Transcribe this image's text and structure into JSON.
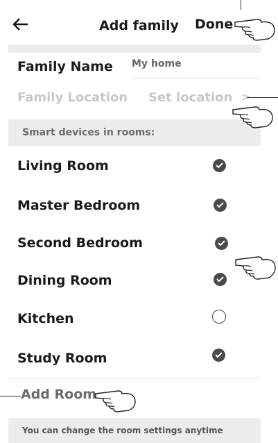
{
  "header": {
    "title": "Add family",
    "done_label": "Done"
  },
  "family_name": {
    "label": "Family Name",
    "value": "My home"
  },
  "family_location": {
    "label": "Family Location",
    "value": "Set location",
    "chevron": ">"
  },
  "section_title": "Smart devices in rooms:",
  "rooms": [
    {
      "name": "Living Room",
      "checked": true
    },
    {
      "name": "Master Bedroom",
      "checked": true
    },
    {
      "name": "Second Bedroom",
      "checked": true
    },
    {
      "name": "Dining Room",
      "checked": true
    },
    {
      "name": "Kitchen",
      "checked": false
    },
    {
      "name": "Study Room",
      "checked": true
    }
  ],
  "add_room_label": "Add Room",
  "footer_note": "You can change the room settings anytime",
  "icons": [
    "back-arrow-icon",
    "check-icon",
    "empty-circle-icon",
    "chevron-right-icon",
    "pointing-hand-icon"
  ]
}
